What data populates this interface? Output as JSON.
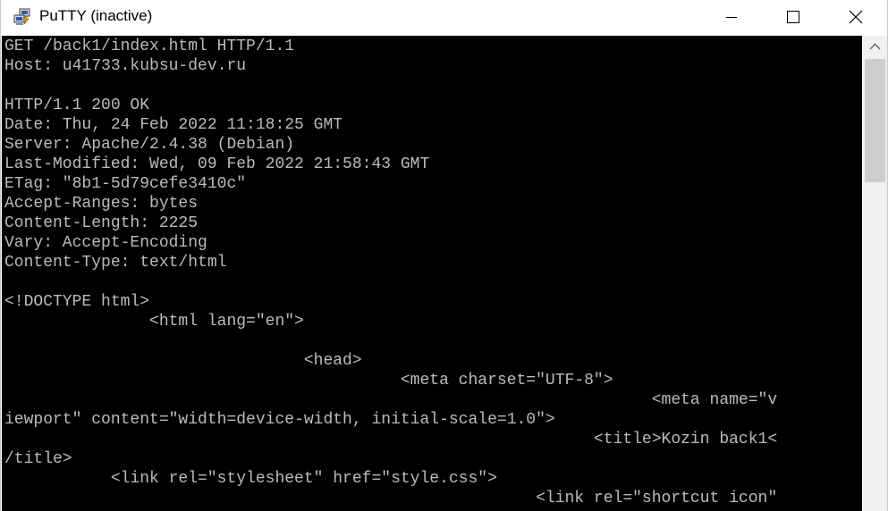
{
  "window": {
    "title": "PuTTY (inactive)",
    "app_icon": "putty-computers-icon",
    "controls": {
      "minimize_icon": "minimize-icon",
      "maximize_icon": "maximize-icon",
      "close_icon": "close-icon"
    }
  },
  "terminal": {
    "background": "#000000",
    "foreground": "#bbbbbb",
    "lines": [
      "GET /back1/index.html HTTP/1.1",
      "Host: u41733.kubsu-dev.ru",
      "",
      "HTTP/1.1 200 OK",
      "Date: Thu, 24 Feb 2022 11:18:25 GMT",
      "Server: Apache/2.4.38 (Debian)",
      "Last-Modified: Wed, 09 Feb 2022 21:58:43 GMT",
      "ETag: \"8b1-5d79cefe3410c\"",
      "Accept-Ranges: bytes",
      "Content-Length: 2225",
      "Vary: Accept-Encoding",
      "Content-Type: text/html",
      "",
      "<!DOCTYPE html>",
      "               <html lang=\"en\">",
      "",
      "                               <head>",
      "                                         <meta charset=\"UTF-8\">",
      "                                                                   <meta name=\"v",
      "iewport\" content=\"width=device-width, initial-scale=1.0\">",
      "                                                             <title>Kozin back1<",
      "/title>",
      "           <link rel=\"stylesheet\" href=\"style.css\">",
      "                                                       <link rel=\"shortcut icon\""
    ]
  },
  "scrollbar": {
    "up_icon": "scroll-up-arrow-icon",
    "position": 0.0
  }
}
